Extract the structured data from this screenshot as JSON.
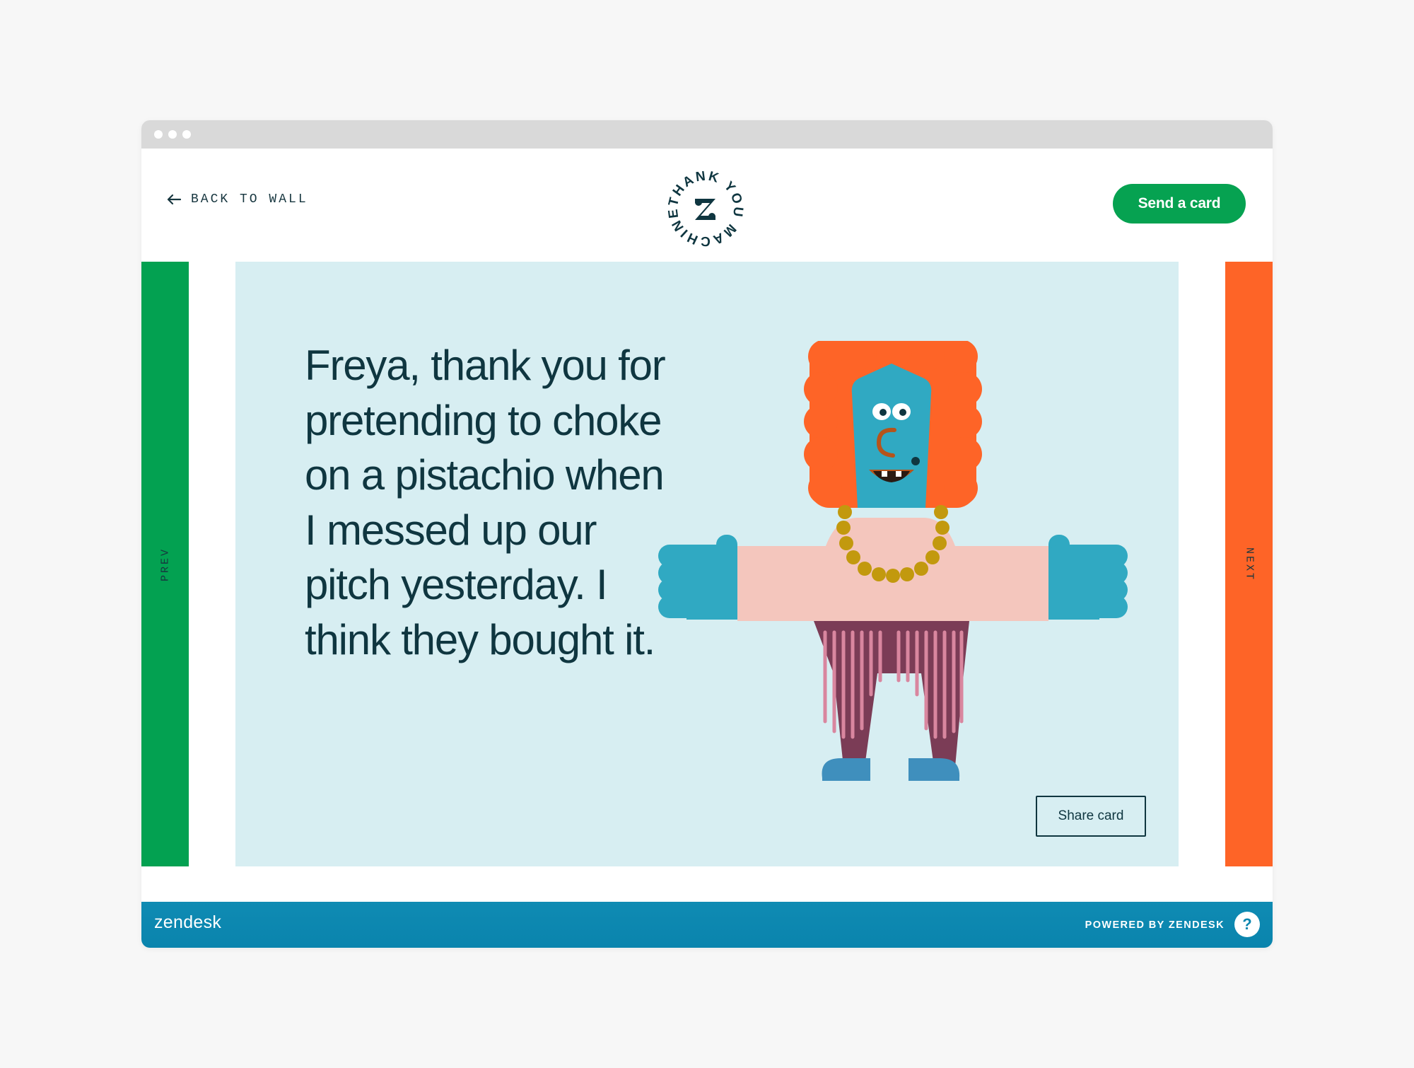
{
  "header": {
    "back_label": "BACK TO WALL",
    "back_icon": "arrow-left-icon",
    "logo_text": "THANK YOU MACHINE",
    "logo_icon": "zendesk-z-icon",
    "send_label": "Send a card"
  },
  "nav": {
    "prev_label": "PREV",
    "next_label": "NEXT"
  },
  "card": {
    "message": "Freya, thank you for pretending to choke on a pistachio when I messed up our pitch yesterday. I think they bought it.",
    "share_label": "Share card"
  },
  "footer": {
    "brand": "zendesk",
    "powered": "POWERED BY ZENDESK",
    "help_label": "?"
  },
  "colors": {
    "page_background": "#f7f7f7",
    "chrome": "#d9d9d9",
    "green": "#03a151",
    "orange": "#fe6427",
    "card_background": "#d7eef2",
    "text_dark": "#0f3640",
    "footer_blue": "#0b86af",
    "hair": "#fe6427",
    "face_teal": "#30a9c2",
    "shirt_pink": "#f4c6bd",
    "pants_plum": "#7b3c56",
    "necklace_gold": "#c2990e"
  }
}
